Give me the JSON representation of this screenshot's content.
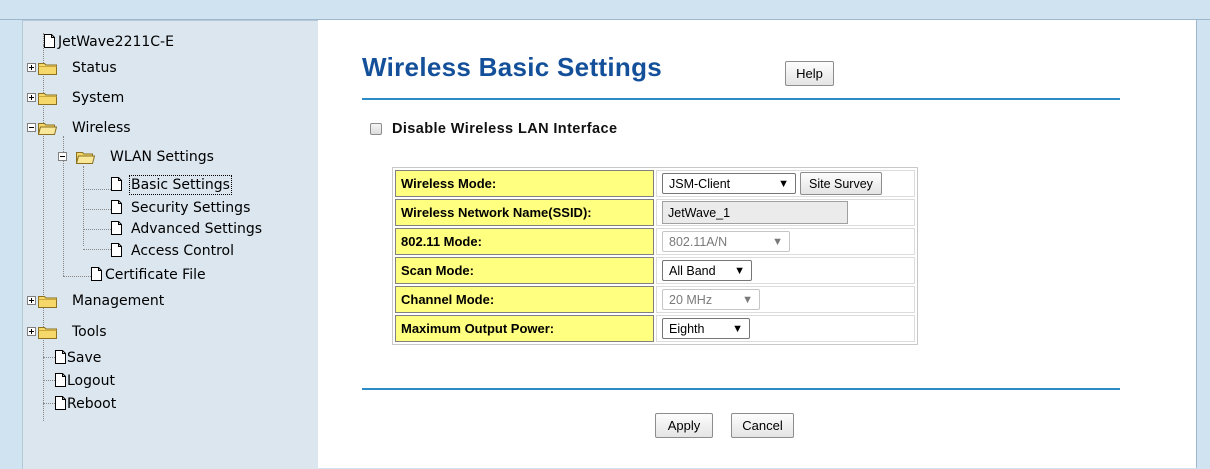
{
  "tree": {
    "root": "JetWave2211C-E",
    "items": [
      {
        "label": "Status"
      },
      {
        "label": "System"
      },
      {
        "label": "Wireless"
      },
      {
        "label": "WLAN Settings"
      },
      {
        "label": "Basic Settings"
      },
      {
        "label": "Security Settings"
      },
      {
        "label": "Advanced Settings"
      },
      {
        "label": "Access Control"
      },
      {
        "label": "Certificate File"
      },
      {
        "label": "Management"
      },
      {
        "label": "Tools"
      },
      {
        "label": "Save"
      },
      {
        "label": "Logout"
      },
      {
        "label": "Reboot"
      }
    ]
  },
  "main": {
    "title": "Wireless Basic Settings",
    "help_label": "Help",
    "disable_label": "Disable Wireless LAN Interface",
    "disable_checked": false,
    "rows": [
      {
        "label": "Wireless Mode:",
        "value": "JSM-Client",
        "button": "Site Survey"
      },
      {
        "label": "Wireless Network Name(SSID):",
        "value": "JetWave_1"
      },
      {
        "label": "802.11 Mode:",
        "value": "802.11A/N"
      },
      {
        "label": "Scan Mode:",
        "value": "All Band"
      },
      {
        "label": "Channel Mode:",
        "value": "20 MHz"
      },
      {
        "label": "Maximum Output Power:",
        "value": "Eighth"
      }
    ],
    "apply_label": "Apply",
    "cancel_label": "Cancel"
  },
  "colors": {
    "title": "#14509a",
    "divider": "#2c8ac4",
    "label_bg": "#ffff80",
    "sidebar_bg": "#dbe6ef"
  }
}
